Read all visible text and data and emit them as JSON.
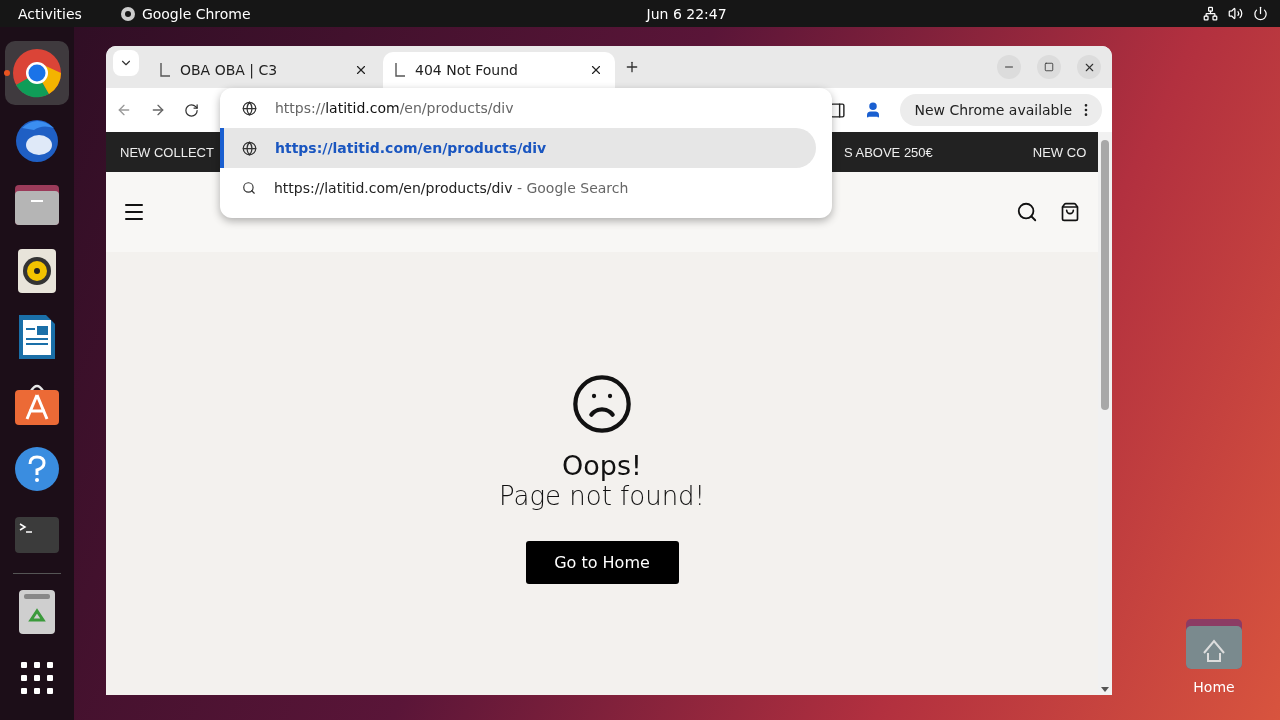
{
  "topbar": {
    "activities": "Activities",
    "app": "Google Chrome",
    "clock": "Jun 6  22:47"
  },
  "dock": [
    {
      "selected": true
    },
    {
      "selected": false
    },
    {
      "selected": false
    },
    {
      "selected": false
    },
    {
      "selected": false
    },
    {
      "selected": false
    },
    {
      "selected": false
    },
    {
      "selected": false
    },
    {
      "selected": false
    }
  ],
  "tabs": [
    {
      "title": "OBA OBA | C3",
      "selected": false
    },
    {
      "title": "404 Not Found",
      "selected": true
    }
  ],
  "omnibox": {
    "scheme": "https://",
    "host": "latitid.com",
    "path": "/en/products/div"
  },
  "suggestions": [
    {
      "kind": "url",
      "text": "https://latitid.com/en/products/div",
      "selected": true
    },
    {
      "kind": "search",
      "text": "https://latitid.com/en/products/div",
      "suffix": "- Google Search",
      "selected": false
    }
  ],
  "update_chip": "New Chrome available",
  "announcements": [
    "NEW COLLECT",
    "S ABOVE 250€",
    "NEW CO"
  ],
  "error": {
    "title": "Oops!",
    "message": "Page not found!",
    "button": "Go to Home"
  },
  "desktop": {
    "home_label": "Home"
  }
}
